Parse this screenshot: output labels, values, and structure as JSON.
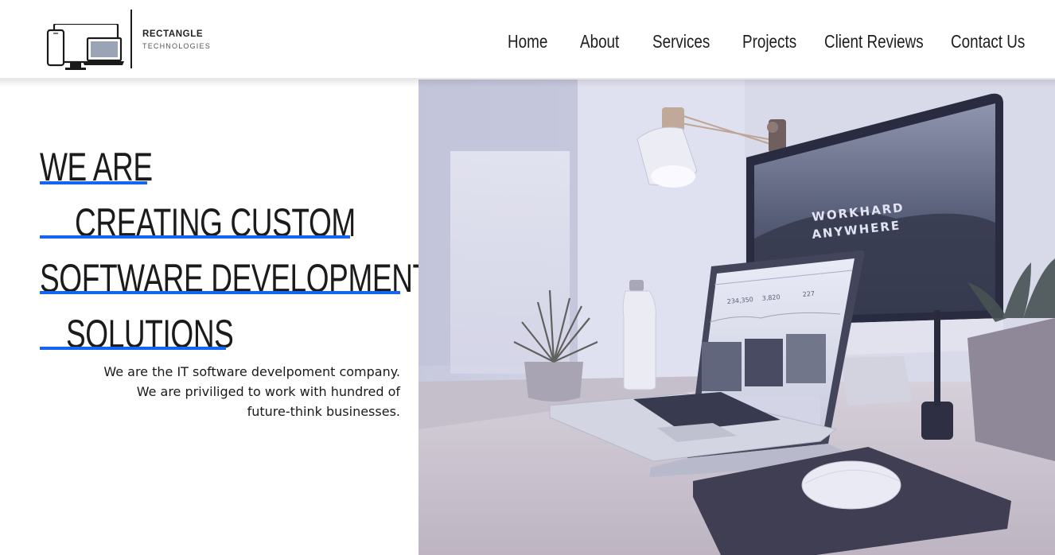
{
  "brand": {
    "name": "RECTANGLE",
    "tagline": "TECHNOLOGIES"
  },
  "nav": {
    "items": [
      {
        "label": "Home"
      },
      {
        "label": "About"
      },
      {
        "label": "Services"
      },
      {
        "label": "Projects"
      },
      {
        "label": "Client Reviews"
      },
      {
        "label": "Contact Us"
      }
    ]
  },
  "hero": {
    "lines": [
      "WE ARE",
      "CREATING CUSTOM",
      "SOFTWARE DEVELOPMENT",
      "SOLUTIONS"
    ],
    "description": [
      "We are the IT software develpoment company.",
      "We are priviliged to work with hundred of",
      "future-think businesses."
    ],
    "accent_color": "#1565f0"
  },
  "hero_image": {
    "monitor_text_1": "WORKHARD",
    "monitor_text_2": "ANYWHERE",
    "laptop_stats": [
      "234,350",
      "3,820",
      "227"
    ]
  }
}
